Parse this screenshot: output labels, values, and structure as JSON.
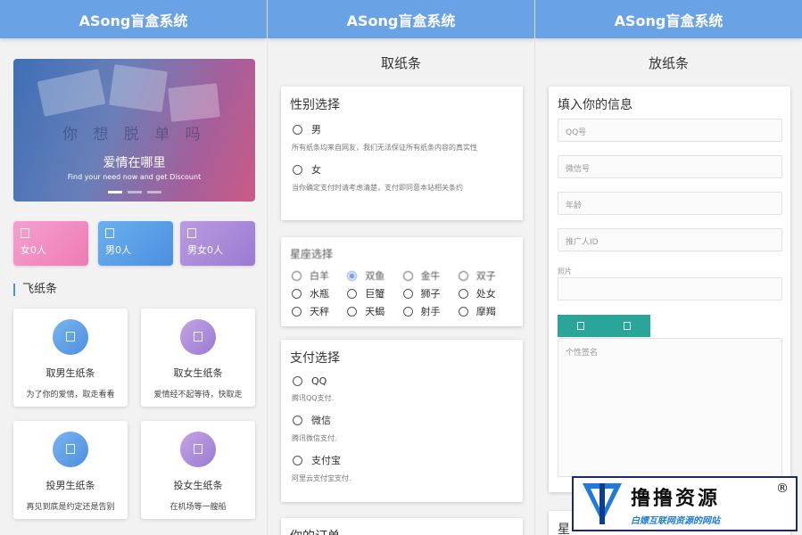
{
  "app_title": "ASong盲盒系统",
  "screen1": {
    "banner": {
      "title": "爱情在哪里",
      "subtitle": "Find your need now and get Discount",
      "bg_text": "你 想 脱 单 吗"
    },
    "stats": [
      {
        "label": "女0人",
        "color": "#ee7cb4"
      },
      {
        "label": "男0人",
        "color": "#4d8fe0"
      },
      {
        "label": "男女0人",
        "color": "#9b7ad3"
      }
    ],
    "section_title": "飞纸条",
    "cards": [
      {
        "title": "取男生纸条",
        "desc": "为了你的爱情，取走看看"
      },
      {
        "title": "取女生纸条",
        "desc": "爱情经不起等待，快取走"
      },
      {
        "title": "投男生纸条",
        "desc": "再见到底是约定还是告别"
      },
      {
        "title": "投女生纸条",
        "desc": "在机场等一艘船"
      }
    ]
  },
  "screen2": {
    "page_title": "取纸条",
    "gender_panel": {
      "title": "性别选择",
      "options": [
        {
          "label": "男",
          "note": "所有纸条均来自网友，我们无法保证所有纸条内容的真实性"
        },
        {
          "label": "女",
          "note": "当你确定支付时请考虑清楚，支付即同意本站相关条约"
        }
      ]
    },
    "zodiac_panel": {
      "title": "星座选择",
      "options": [
        "白羊",
        "双鱼",
        "金牛",
        "巨蟹",
        "处女",
        "狮子",
        "水瓶",
        "天秤",
        "天蝎",
        "射手",
        "摩羯",
        "双子"
      ]
    },
    "pay_panel": {
      "title": "支付选择",
      "options": [
        {
          "label": "QQ",
          "note": "腾讯QQ支付."
        },
        {
          "label": "微信",
          "note": "腾讯微信支付."
        },
        {
          "label": "支付宝",
          "note": "阿里云支付宝支付."
        }
      ]
    },
    "next_panel_title": "你的订单"
  },
  "screen3": {
    "page_title": "放纸条",
    "panel_title": "填入你的信息",
    "fields": [
      {
        "placeholder": "QQ号"
      },
      {
        "placeholder": "微信号"
      },
      {
        "placeholder": "年龄"
      },
      {
        "placeholder": "推广人ID"
      }
    ],
    "photo_label": "照片",
    "signature_placeholder": "个性签名",
    "next_panel_title": "星"
  },
  "watermark": {
    "main": "撸撸资源",
    "sub": "白嫖互联网资源的网站",
    "reg": "®"
  }
}
